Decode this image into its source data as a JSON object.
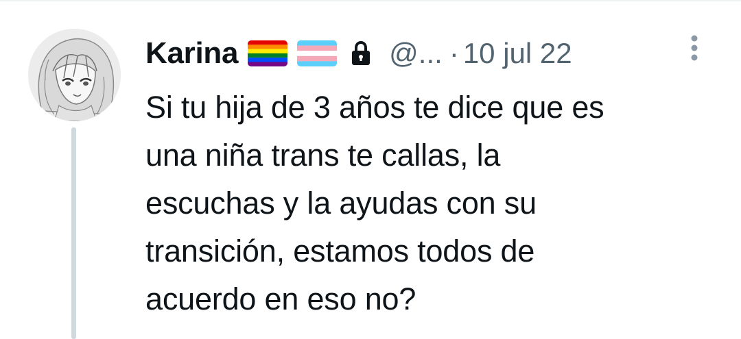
{
  "tweet": {
    "display_name": "Karina",
    "handle": "@...",
    "separator": "·",
    "timestamp": "10 jul 22",
    "text_lines": [
      "Si tu hija de 3 años te dice que es",
      "una niña trans te callas, la",
      "escuchas y la ayudas con su",
      "transición, estamos todos de",
      "acuerdo en eso no?"
    ],
    "badges": [
      "rainbow-flag-emoji",
      "transgender-flag-emoji",
      "lock-icon"
    ]
  },
  "colors": {
    "text_primary": "#0f1419",
    "text_secondary": "#536471",
    "thread_line": "#cfd9de",
    "divider": "#eff3f4"
  }
}
